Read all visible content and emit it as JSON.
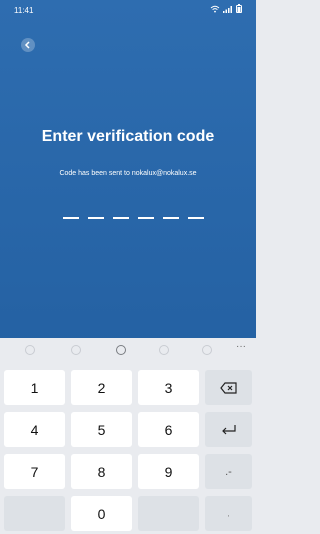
{
  "status_bar": {
    "time": "11:41",
    "icons": [
      "wifi-icon",
      "signal-icon",
      "battery-icon"
    ]
  },
  "nav": {
    "back_icon": "chevron-left-icon"
  },
  "verification": {
    "title": "Enter verification code",
    "subtitle": "Code has been sent to nokalux@nokalux.se",
    "code_length": 6
  },
  "keyboard": {
    "toolbar_icons": [
      "emoji-icon",
      "mic-icon",
      "settings-icon",
      "search-icon",
      "clipboard-icon",
      "more-icon"
    ],
    "more_label": "···",
    "keys": [
      {
        "label": "1"
      },
      {
        "label": "2"
      },
      {
        "label": "3"
      },
      {
        "label": "backspace"
      },
      {
        "label": "4"
      },
      {
        "label": "5"
      },
      {
        "label": "6"
      },
      {
        "label": "enter"
      },
      {
        "label": "7"
      },
      {
        "label": "8"
      },
      {
        "label": "9"
      },
      {
        "label": ".-"
      },
      {
        "label": ""
      },
      {
        "label": "0"
      },
      {
        "label": ""
      },
      {
        "label": ","
      }
    ]
  },
  "colors": {
    "background_top": "#2e6db0",
    "background_bottom": "#1f5b9c",
    "keyboard_bg": "#e9ebef",
    "key_bg": "#ffffff",
    "fn_key_bg": "#dde1e6"
  }
}
